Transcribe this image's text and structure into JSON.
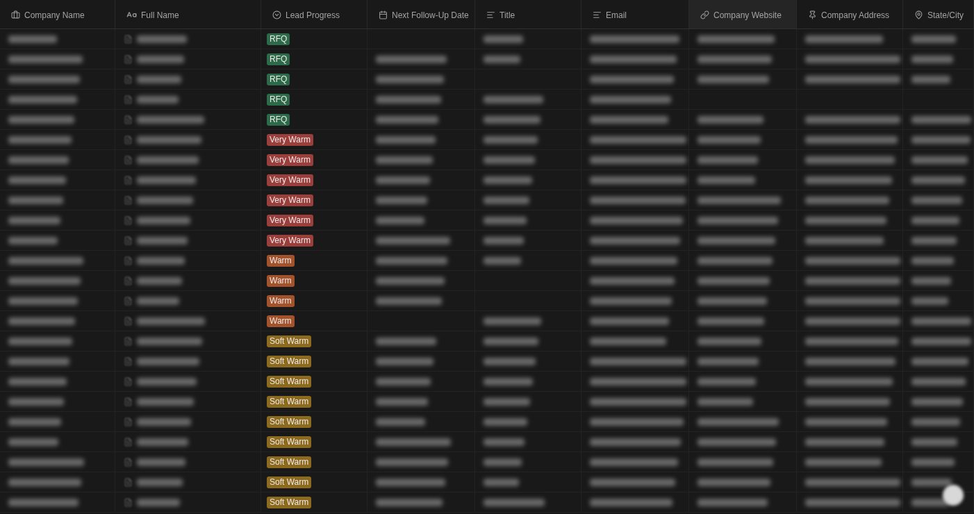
{
  "columns": [
    {
      "label": "Company Name",
      "kind": "briefcase",
      "selected": false
    },
    {
      "label": "Full Name",
      "kind": "text",
      "selected": false
    },
    {
      "label": "Lead Progress",
      "kind": "select",
      "selected": false
    },
    {
      "label": "Next Follow-Up Date",
      "kind": "date",
      "selected": false
    },
    {
      "label": "Title",
      "kind": "lines",
      "selected": false
    },
    {
      "label": "Email",
      "kind": "lines",
      "selected": false
    },
    {
      "label": "Company Website",
      "kind": "link",
      "selected": true
    },
    {
      "label": "Company Address",
      "kind": "pin",
      "selected": false
    },
    {
      "label": "State/City",
      "kind": "place",
      "selected": false
    }
  ],
  "rows": [
    {
      "tag": "RFQ",
      "color": "#2d6a4a"
    },
    {
      "tag": "RFQ",
      "color": "#2d6a4a"
    },
    {
      "tag": "RFQ",
      "color": "#2d6a4a"
    },
    {
      "tag": "RFQ",
      "color": "#2d6a4a"
    },
    {
      "tag": "RFQ",
      "color": "#2d6a4a"
    },
    {
      "tag": "Very Warm",
      "color": "#9b3f3c"
    },
    {
      "tag": "Very Warm",
      "color": "#9b3f3c"
    },
    {
      "tag": "Very Warm",
      "color": "#9b3f3c"
    },
    {
      "tag": "Very Warm",
      "color": "#9b3f3c"
    },
    {
      "tag": "Very Warm",
      "color": "#9b3f3c"
    },
    {
      "tag": "Very Warm",
      "color": "#9b3f3c"
    },
    {
      "tag": "Warm",
      "color": "#a2532c"
    },
    {
      "tag": "Warm",
      "color": "#a2532c"
    },
    {
      "tag": "Warm",
      "color": "#a2532c"
    },
    {
      "tag": "Warm",
      "color": "#a2532c"
    },
    {
      "tag": "Soft Warm",
      "color": "#8c6a1e"
    },
    {
      "tag": "Soft Warm",
      "color": "#8c6a1e"
    },
    {
      "tag": "Soft Warm",
      "color": "#8c6a1e"
    },
    {
      "tag": "Soft Warm",
      "color": "#8c6a1e"
    },
    {
      "tag": "Soft Warm",
      "color": "#8c6a1e"
    },
    {
      "tag": "Soft Warm",
      "color": "#8c6a1e"
    },
    {
      "tag": "Soft Warm",
      "color": "#8c6a1e"
    },
    {
      "tag": "Soft Warm",
      "color": "#8c6a1e"
    },
    {
      "tag": "Soft Warm",
      "color": "#8c6a1e"
    }
  ]
}
